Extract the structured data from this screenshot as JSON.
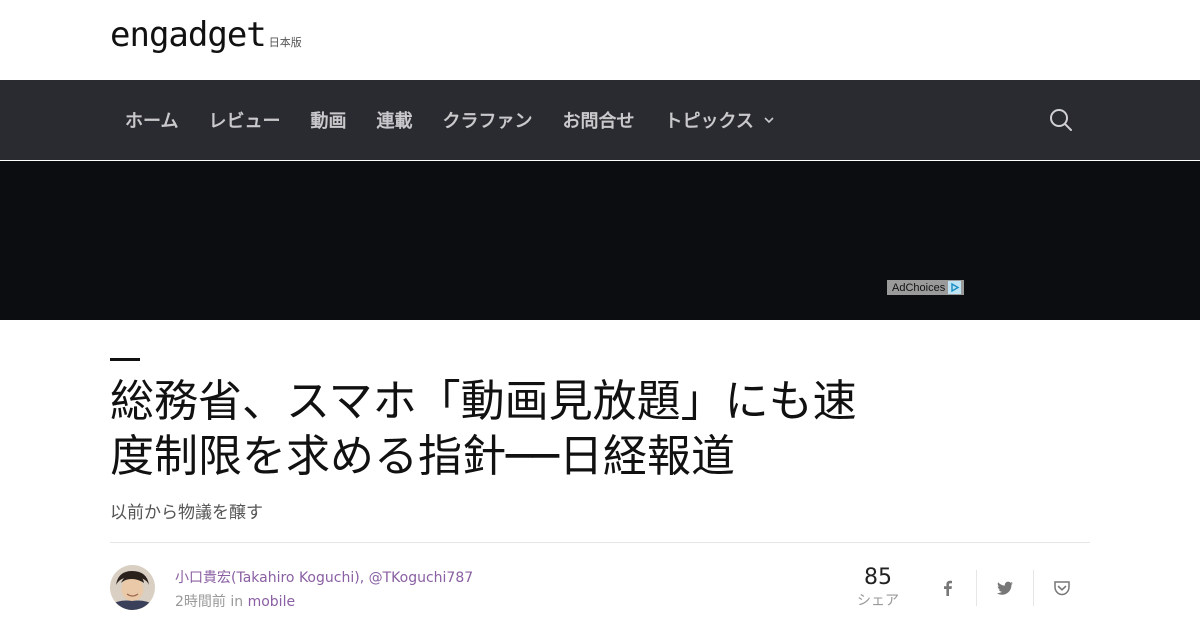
{
  "header": {
    "logo_text": "engadget",
    "edition": "日本版"
  },
  "nav": {
    "items": [
      {
        "label": "ホーム"
      },
      {
        "label": "レビュー"
      },
      {
        "label": "動画"
      },
      {
        "label": "連載"
      },
      {
        "label": "クラファン"
      },
      {
        "label": "お問合せ"
      },
      {
        "label": "トピックス",
        "icon": "chevron-down-icon"
      }
    ],
    "search_icon": "search-icon"
  },
  "ad": {
    "label": "AdChoices",
    "icon": "adchoices-icon"
  },
  "article": {
    "title_line1": "総務省、スマホ「動画見放題」にも速",
    "title_line2": "度制限を求める指針──日経報道",
    "subtitle": "以前から物議を醸す",
    "author": {
      "name": "小口貴宏(Takahiro Koguchi)",
      "handle": "@TKoguchi787",
      "separator": ","
    },
    "posted": "2時間前",
    "in_label": "in",
    "category": "mobile"
  },
  "share": {
    "count": "85",
    "label": "シェア",
    "buttons": [
      "facebook-icon",
      "twitter-icon",
      "pocket-icon"
    ]
  },
  "colors": {
    "nav_bg": "#2a2b30",
    "hero_bg": "#0c0d10",
    "link": "#8a5fa3"
  }
}
